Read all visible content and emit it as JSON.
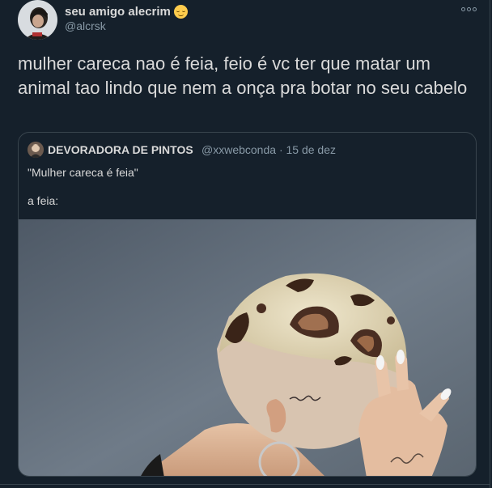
{
  "tweet": {
    "display_name": "seu amigo alecrim",
    "emoji": "relieved-face-emoji",
    "handle": "@alcrsk",
    "text": "mulher careca nao é feia, feio é vc ter que matar um animal tao lindo que nem a onça pra botar no seu cabelo",
    "more_icon": "more-options-icon"
  },
  "quoted_tweet": {
    "display_name": "DEVORADORA DE PINTOS",
    "handle": "@xxwebconda",
    "separator": "·",
    "date": "15 de dez",
    "line1": "\"Mulher careca é feia\"",
    "line2": "a feia:",
    "image": "photo-woman-leopard-print-buzzcut"
  },
  "colors": {
    "background": "#15202b",
    "border": "#38444d",
    "text_primary": "#d9d9d9",
    "text_secondary": "#8899a6"
  }
}
